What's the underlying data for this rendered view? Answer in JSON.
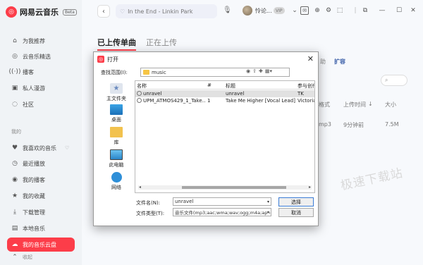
{
  "app": {
    "name": "网易云音乐",
    "badge": "Beta",
    "logo_glyph": "◎"
  },
  "sidebar": {
    "items_top": [
      {
        "label": "为我推荐",
        "icon": "home-icon"
      },
      {
        "label": "云音乐精选",
        "icon": "compass-icon"
      },
      {
        "label": "播客",
        "icon": "radio-icon"
      },
      {
        "label": "私人漫游",
        "icon": "roaming-icon"
      },
      {
        "label": "社区",
        "icon": "community-icon"
      }
    ],
    "section_label": "我的",
    "items_my": [
      {
        "label": "我喜欢的音乐",
        "icon": "heart-icon"
      },
      {
        "label": "最近播放",
        "icon": "recent-icon"
      },
      {
        "label": "我的播客",
        "icon": "podcast-icon"
      },
      {
        "label": "我的收藏",
        "icon": "star-icon"
      },
      {
        "label": "下载管理",
        "icon": "download-icon"
      },
      {
        "label": "本地音乐",
        "icon": "local-music-icon"
      },
      {
        "label": "我的音乐云盘",
        "icon": "cloud-icon",
        "active": true
      }
    ],
    "collapse_label": "收起"
  },
  "topbar": {
    "search_placeholder": "In the End - Linkin Park",
    "user_name": "怜论...",
    "vip_badge": "VIP"
  },
  "main": {
    "tabs": [
      {
        "label": "已上传单曲",
        "active": true
      },
      {
        "label": "正在上传",
        "active": false
      }
    ],
    "bg_link": "扩容",
    "bg_partial": "助",
    "columns": [
      "格式",
      "上传时间",
      "大小"
    ],
    "row_values": [
      "mp3",
      "9分钟前",
      "7.5M"
    ],
    "watermark": "极速下载站"
  },
  "dialog": {
    "title": "打开",
    "look_in_label": "查找范围(I):",
    "look_in_value": "music",
    "places": [
      "主文件夹",
      "桌面",
      "库",
      "此电脑",
      "网络"
    ],
    "columns": [
      "名称",
      "#",
      "标题",
      "参与创作"
    ],
    "files": [
      {
        "name": "unravel",
        "track": "",
        "title": "unravel",
        "artist": "TK",
        "selected": true
      },
      {
        "name": "UPM_ATMOS429_1_Take...",
        "track": "1",
        "title": "Take Me Higher [Vocal Lead]",
        "artist": "Victoria",
        "selected": false
      }
    ],
    "file_name_label": "文件名(N):",
    "file_name_value": "unravel",
    "file_type_label": "文件类型(T):",
    "file_type_value": "音乐文件(mp3;aac;wma;wav;ogg;m4a;ape;f",
    "open_button": "选择",
    "cancel_button": "取消"
  },
  "colors": {
    "accent": "#fc3d49",
    "sidebar_bg": "#f0f3f6",
    "page_bg": "#f7f9fc"
  }
}
